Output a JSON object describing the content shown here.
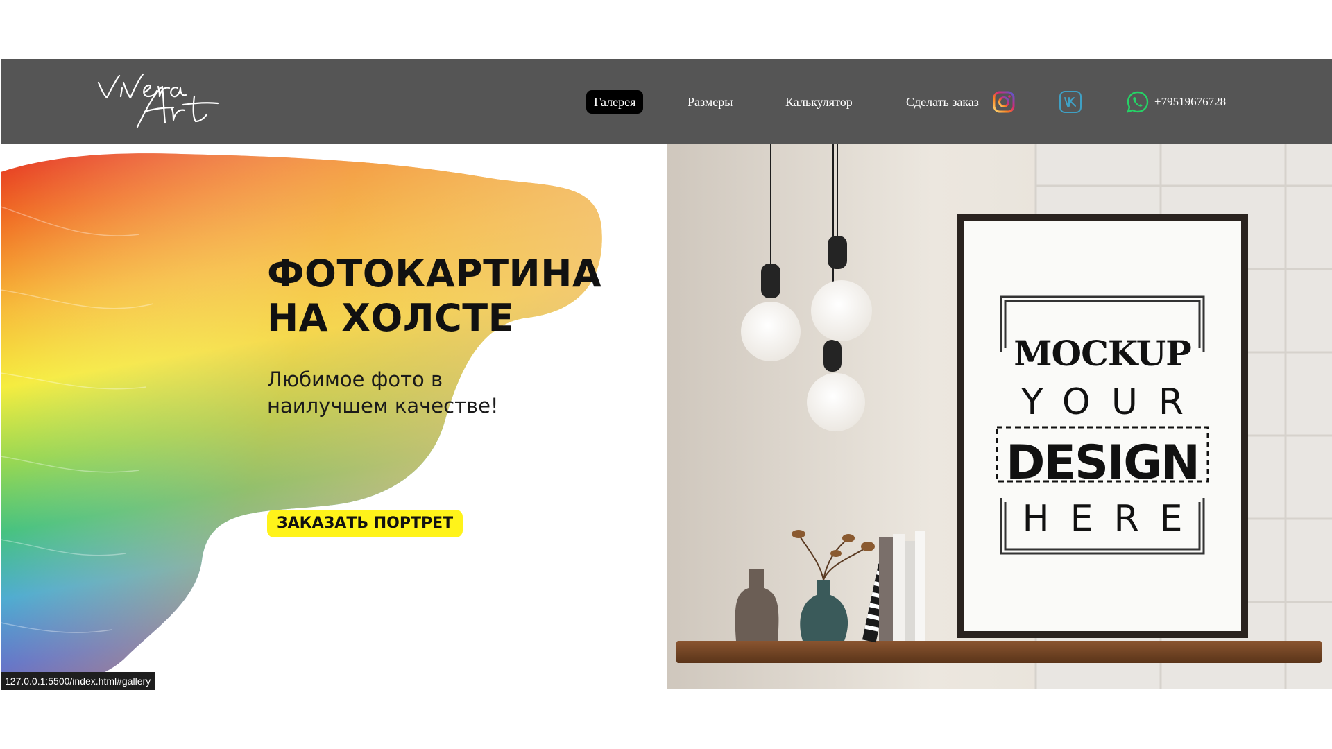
{
  "header": {
    "logo_text_1": "ViVera",
    "logo_text_2": "Art",
    "nav": {
      "gallery": "Галерея",
      "sizes": "Размеры",
      "calculator": "Калькулятор",
      "order": "Сделать заказ"
    },
    "phone": "+79519676728",
    "icons": [
      "instagram-icon",
      "vk-icon",
      "whatsapp-icon"
    ],
    "active_item": "gallery"
  },
  "hero": {
    "title_line_1": "ФОТОКАРТИНА",
    "title_line_2": "НА ХОЛСТЕ",
    "subtitle_line_1": "Любимое фото в",
    "subtitle_line_2": "наилучшем качестве!",
    "cta_label": "ЗАКАЗАТЬ ПОРТРЕТ"
  },
  "mockup": {
    "line_1": "MOCKUP",
    "line_2": "YOUR",
    "line_3": "DESIGN",
    "line_4": "HERE"
  },
  "status_bar": {
    "url": "127.0.0.1:5500/index.html#gallery"
  },
  "colors": {
    "header_bg": "#555555",
    "active_nav_bg": "#000000",
    "cta_bg": "#fff31a",
    "instagram": "#e1306c",
    "vk": "#4c75a3",
    "whatsapp": "#25d366"
  }
}
